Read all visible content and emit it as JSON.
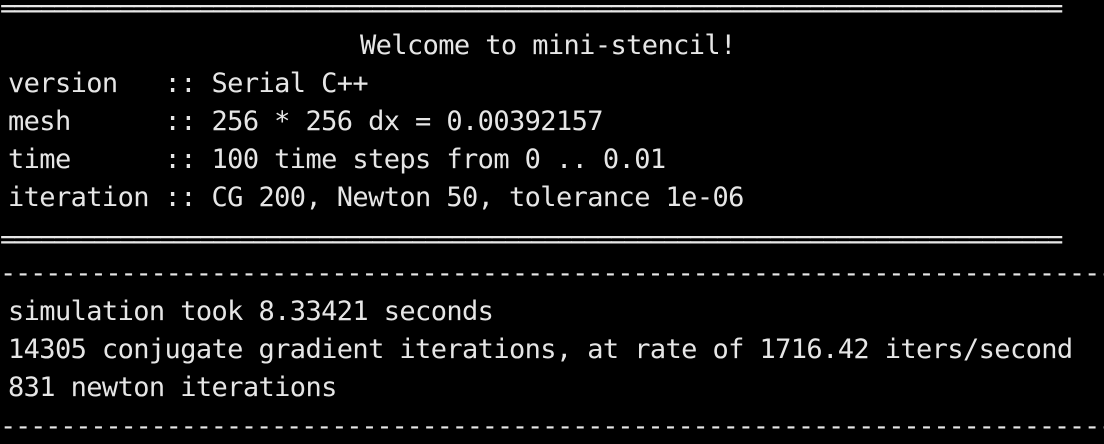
{
  "banner": {
    "top_rule": "================================================================================",
    "title": "Welcome to mini-stencil!",
    "rows": [
      "version   :: Serial C++",
      "mesh      :: 256 * 256 dx = 0.00392157",
      "time      :: 100 time steps from 0 .. 0.01",
      "iteration :: CG 200, Newton 50, tolerance 1e-06"
    ],
    "bottom_rule": "================================================================================"
  },
  "summary": {
    "top_rule": "--------------------------------------------------------------------------------",
    "lines": [
      "simulation took 8.33421 seconds",
      "14305 conjugate gradient iterations, at rate of 1716.42 iters/second",
      "831 newton iterations"
    ],
    "bottom_rule": "--------------------------------------------------------------------------------"
  },
  "colors": {
    "background": "#000000",
    "foreground": "#e6e6e6"
  }
}
